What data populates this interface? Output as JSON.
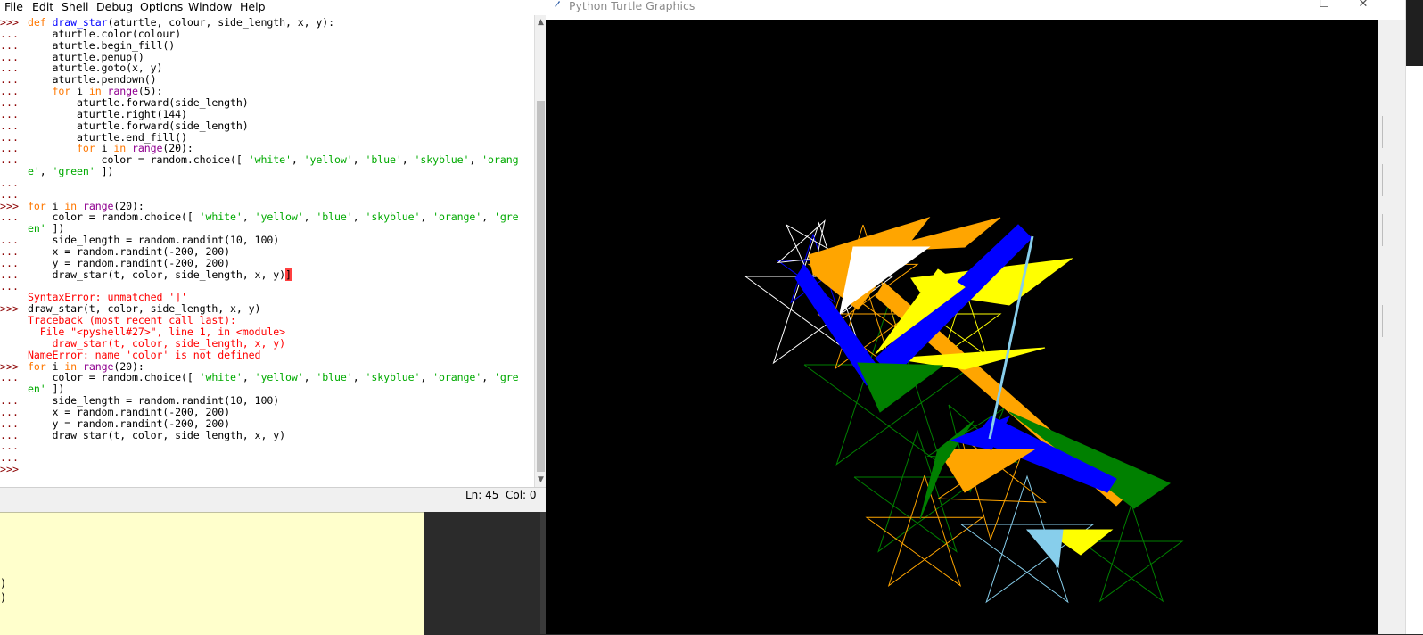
{
  "idle": {
    "menu": [
      "File",
      "Edit",
      "Shell",
      "Debug",
      "Options",
      "Window",
      "Help"
    ],
    "lines": [
      {
        "p": ">>>",
        "t": [
          [
            "def",
            "kw"
          ],
          [
            " ",
            ""
          ],
          [
            "draw_star",
            "fn"
          ],
          [
            "(aturtle, colour, side_length, x, y):",
            ""
          ]
        ]
      },
      {
        "p": "...",
        "t": [
          [
            "    aturtle.color(colour)",
            ""
          ]
        ]
      },
      {
        "p": "...",
        "t": [
          [
            "    aturtle.begin_fill()",
            ""
          ]
        ]
      },
      {
        "p": "...",
        "t": [
          [
            "    aturtle.penup()",
            ""
          ]
        ]
      },
      {
        "p": "...",
        "t": [
          [
            "    aturtle.goto(x, y)",
            ""
          ]
        ]
      },
      {
        "p": "...",
        "t": [
          [
            "    aturtle.pendown()",
            ""
          ]
        ]
      },
      {
        "p": "...",
        "t": [
          [
            "    ",
            ""
          ],
          [
            "for",
            "kw"
          ],
          [
            " i ",
            ""
          ],
          [
            "in",
            "kw"
          ],
          [
            " ",
            ""
          ],
          [
            "range",
            "bi"
          ],
          [
            "(5):",
            ""
          ]
        ]
      },
      {
        "p": "...",
        "t": [
          [
            "        aturtle.forward(side_length)",
            ""
          ]
        ]
      },
      {
        "p": "...",
        "t": [
          [
            "        aturtle.right(144)",
            ""
          ]
        ]
      },
      {
        "p": "...",
        "t": [
          [
            "        aturtle.forward(side_length)",
            ""
          ]
        ]
      },
      {
        "p": "...",
        "t": [
          [
            "        aturtle.end_fill()",
            ""
          ]
        ]
      },
      {
        "p": "...",
        "t": [
          [
            "        ",
            ""
          ],
          [
            "for",
            "kw"
          ],
          [
            " i ",
            ""
          ],
          [
            "in",
            "kw"
          ],
          [
            " ",
            ""
          ],
          [
            "range",
            "bi"
          ],
          [
            "(20):",
            ""
          ]
        ]
      },
      {
        "p": "...",
        "t": [
          [
            "            color = random.choice([ ",
            ""
          ],
          [
            "'white'",
            "st"
          ],
          [
            ", ",
            ""
          ],
          [
            "'yellow'",
            "st"
          ],
          [
            ", ",
            ""
          ],
          [
            "'blue'",
            "st"
          ],
          [
            ", ",
            ""
          ],
          [
            "'skyblue'",
            "st"
          ],
          [
            ", ",
            ""
          ],
          [
            "'orang",
            "st"
          ]
        ]
      },
      {
        "p": "",
        "t": [
          [
            "e'",
            "st"
          ],
          [
            ", ",
            ""
          ],
          [
            "'green'",
            "st"
          ],
          [
            " ])",
            ""
          ]
        ]
      },
      {
        "p": "...",
        "t": [
          [
            "",
            ""
          ]
        ]
      },
      {
        "p": "...",
        "t": [
          [
            "",
            ""
          ]
        ]
      },
      {
        "p": ">>>",
        "t": [
          [
            "for",
            "kw"
          ],
          [
            " i ",
            ""
          ],
          [
            "in",
            "kw"
          ],
          [
            " ",
            ""
          ],
          [
            "range",
            "bi"
          ],
          [
            "(20):",
            ""
          ]
        ]
      },
      {
        "p": "...",
        "t": [
          [
            "    color = random.choice([ ",
            ""
          ],
          [
            "'white'",
            "st"
          ],
          [
            ", ",
            ""
          ],
          [
            "'yellow'",
            "st"
          ],
          [
            ", ",
            ""
          ],
          [
            "'blue'",
            "st"
          ],
          [
            ", ",
            ""
          ],
          [
            "'skyblue'",
            "st"
          ],
          [
            ", ",
            ""
          ],
          [
            "'orange'",
            "st"
          ],
          [
            ", ",
            ""
          ],
          [
            "'gre",
            "st"
          ]
        ]
      },
      {
        "p": "",
        "t": [
          [
            "en'",
            "st"
          ],
          [
            " ])",
            ""
          ]
        ]
      },
      {
        "p": "...",
        "t": [
          [
            "    side_length = random.randint(10, 100)",
            ""
          ]
        ]
      },
      {
        "p": "...",
        "t": [
          [
            "    x = random.randint(-200, 200)",
            ""
          ]
        ]
      },
      {
        "p": "...",
        "t": [
          [
            "    y = random.randint(-200, 200)",
            ""
          ]
        ]
      },
      {
        "p": "...",
        "t": [
          [
            "    draw_star(t, color, side_length, x, y)",
            ""
          ],
          [
            "]",
            "err"
          ]
        ]
      },
      {
        "p": "...",
        "t": [
          [
            "",
            ""
          ]
        ]
      },
      {
        "p": "",
        "t": [
          [
            "SyntaxError: unmatched ']'",
            "red"
          ]
        ]
      },
      {
        "p": ">>>",
        "t": [
          [
            "draw_star(t, color, side_length, x, y)",
            ""
          ]
        ]
      },
      {
        "p": "",
        "t": [
          [
            "Traceback (most recent call last):",
            "red"
          ]
        ]
      },
      {
        "p": "",
        "t": [
          [
            "  File \"<pyshell#27>\", line 1, in <module>",
            "red"
          ]
        ]
      },
      {
        "p": "",
        "t": [
          [
            "    draw_star(t, color, side_length, x, y)",
            "red"
          ]
        ]
      },
      {
        "p": "",
        "t": [
          [
            "NameError: name 'color' is not defined",
            "red"
          ]
        ]
      },
      {
        "p": ">>>",
        "t": [
          [
            "for",
            "kw"
          ],
          [
            " i ",
            ""
          ],
          [
            "in",
            "kw"
          ],
          [
            " ",
            ""
          ],
          [
            "range",
            "bi"
          ],
          [
            "(20):",
            ""
          ]
        ]
      },
      {
        "p": "...",
        "t": [
          [
            "    color = random.choice([ ",
            ""
          ],
          [
            "'white'",
            "st"
          ],
          [
            ", ",
            ""
          ],
          [
            "'yellow'",
            "st"
          ],
          [
            ", ",
            ""
          ],
          [
            "'blue'",
            "st"
          ],
          [
            ", ",
            ""
          ],
          [
            "'skyblue'",
            "st"
          ],
          [
            ", ",
            ""
          ],
          [
            "'orange'",
            "st"
          ],
          [
            ", ",
            ""
          ],
          [
            "'gre",
            "st"
          ]
        ]
      },
      {
        "p": "",
        "t": [
          [
            "en'",
            "st"
          ],
          [
            " ])",
            ""
          ]
        ]
      },
      {
        "p": "...",
        "t": [
          [
            "    side_length = random.randint(10, 100)",
            ""
          ]
        ]
      },
      {
        "p": "...",
        "t": [
          [
            "    x = random.randint(-200, 200)",
            ""
          ]
        ]
      },
      {
        "p": "...",
        "t": [
          [
            "    y = random.randint(-200, 200)",
            ""
          ]
        ]
      },
      {
        "p": "...",
        "t": [
          [
            "    draw_star(t, color, side_length, x, y)",
            ""
          ]
        ]
      },
      {
        "p": "...",
        "t": [
          [
            "",
            ""
          ]
        ]
      },
      {
        "p": "...",
        "t": [
          [
            "",
            ""
          ]
        ]
      },
      {
        "p": ">>>",
        "t": [
          [
            "",
            ""
          ]
        ]
      }
    ],
    "status_ln": "Ln: 45",
    "status_col": "Col: 0",
    "colors": {
      "kw": "#ff7700",
      "fn": "#0000ff",
      "bi": "#900090",
      "st": "#00aa00",
      "red": "#ff0000",
      "prompt": "#8b0000"
    }
  },
  "background_window": {
    "visible_chars": [
      ")",
      ")"
    ]
  },
  "turtle": {
    "title": "Python Turtle Graphics",
    "buttons": {
      "minimize": "—",
      "maximize": "☐",
      "close": "✕"
    },
    "canvas_color": "#000000",
    "star_colors": [
      "white",
      "yellow",
      "blue",
      "skyblue",
      "orange",
      "green"
    ]
  }
}
